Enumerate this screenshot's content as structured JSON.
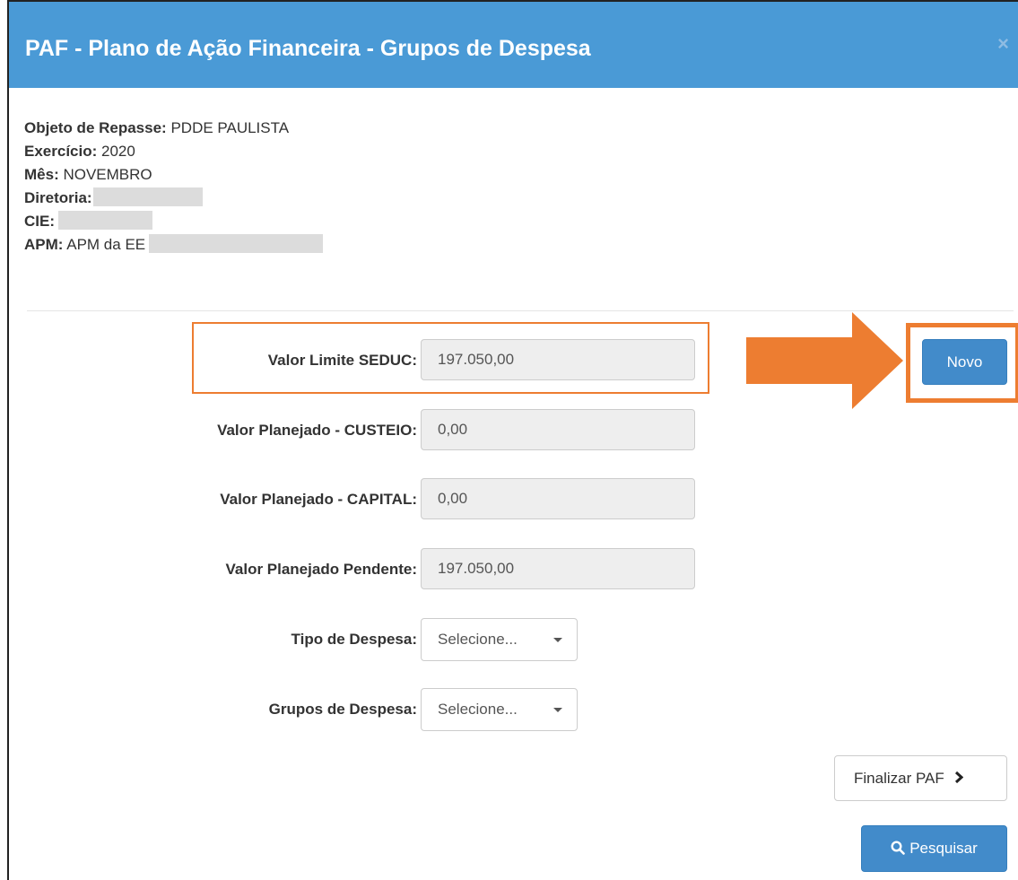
{
  "modal": {
    "title": "PAF - Plano de Ação Financeira - Grupos de Despesa",
    "close_symbol": "×"
  },
  "info": {
    "objeto_label": "Objeto de Repasse:",
    "objeto_value": "PDDE PAULISTA",
    "exercicio_label": "Exercício:",
    "exercicio_value": "2020",
    "mes_label": "Mês:",
    "mes_value": "NOVEMBRO",
    "diretoria_label": "Diretoria:",
    "cie_label": "CIE:",
    "apm_label": "APM:",
    "apm_value": "APM da EE"
  },
  "form": {
    "limite_label": "Valor Limite SEDUC:",
    "limite_value": "197.050,00",
    "custeio_label": "Valor Planejado - CUSTEIO:",
    "custeio_value": "0,00",
    "capital_label": "Valor Planejado - CAPITAL:",
    "capital_value": "0,00",
    "pendente_label": "Valor Planejado Pendente:",
    "pendente_value": "197.050,00",
    "tipo_label": "Tipo de Despesa:",
    "tipo_selected": "Selecione...",
    "grupos_label": "Grupos de Despesa:",
    "grupos_selected": "Selecione..."
  },
  "buttons": {
    "novo": "Novo",
    "finalizar": "Finalizar PAF",
    "pesquisar": "Pesquisar"
  },
  "icons": {
    "finalizar": "chevron-right-icon",
    "pesquisar": "search-icon",
    "arrow": "arrow-right-icon"
  },
  "colors": {
    "header": "#4a9ad6",
    "annotation": "#ed7d31",
    "primary": "#428bca"
  }
}
